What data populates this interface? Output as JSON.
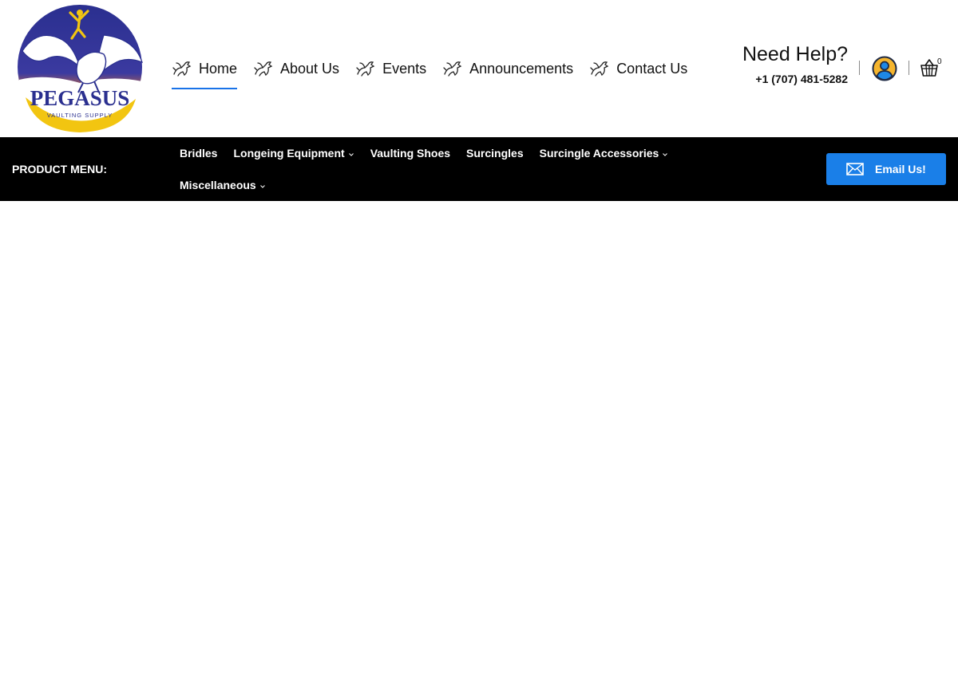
{
  "logo": {
    "brand": "PEGASUS",
    "tagline": "VAULTING SUPPLY"
  },
  "main_nav": [
    {
      "label": "Home",
      "icon": "horse-icon",
      "active": true
    },
    {
      "label": "About Us",
      "icon": "horse-icon"
    },
    {
      "label": "Events",
      "icon": "horse-icon"
    },
    {
      "label": "Announcements",
      "icon": "horse-icon"
    },
    {
      "label": "Contact Us",
      "icon": "horse-icon"
    }
  ],
  "help": {
    "title": "Need Help?",
    "phone": "+1 (707) 481-5282"
  },
  "account": {
    "icon": "user-account-icon"
  },
  "cart": {
    "icon": "shopping-basket-icon",
    "count": "0"
  },
  "product_menu": {
    "title": "PRODUCT MENU:",
    "links": [
      {
        "label": "Bridles",
        "dropdown": false
      },
      {
        "label": "Longeing Equipment",
        "dropdown": true
      },
      {
        "label": "Vaulting Shoes",
        "dropdown": false
      },
      {
        "label": "Surcingles",
        "dropdown": false
      },
      {
        "label": "Surcingle Accessories",
        "dropdown": true
      },
      {
        "label": "Miscellaneous",
        "dropdown": true
      }
    ]
  },
  "email_button": {
    "label": "Email Us!",
    "icon": "mail-icon"
  },
  "colors": {
    "accent_blue": "#1a7fe8",
    "active_underline": "#1a73e8",
    "bar_background": "#000000",
    "logo_navy": "#2a2f8f",
    "logo_gold": "#f2c511"
  }
}
